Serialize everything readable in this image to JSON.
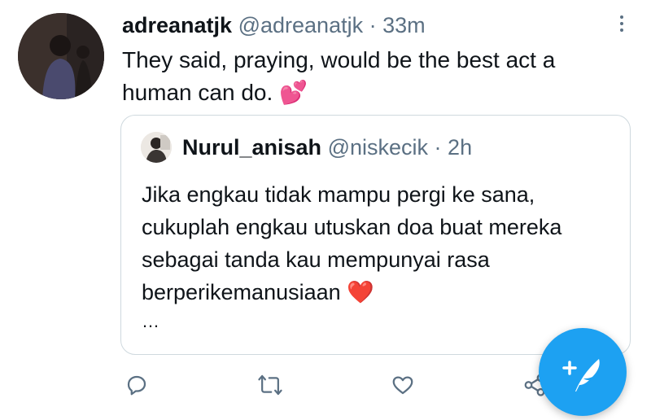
{
  "tweet": {
    "display_name": "adreanatjk",
    "handle": "@adreanatjk",
    "separator": "·",
    "time": "33m",
    "text": "They said, praying, would be the best act a human can do.",
    "emoji": "💕"
  },
  "quoted_tweet": {
    "display_name": "Nurul_anisah",
    "handle": "@niskecik",
    "separator": "·",
    "time": "2h",
    "text": "Jika engkau tidak mampu pergi ke sana, cukuplah engkau utuskan doa buat mereka sebagai tanda kau mempunyai rasa berperikemanusiaan",
    "emoji": "❤️",
    "truncation": "…"
  },
  "actions": {
    "icons": [
      "reply-icon",
      "retweet-icon",
      "like-icon",
      "share-icon"
    ]
  },
  "fab": {
    "icon": "compose-tweet-icon",
    "color": "#1da1f2"
  },
  "colors": {
    "text": "#0f1419",
    "muted": "#5b7083",
    "accent": "#1da1f2",
    "border": "#cfd9de"
  }
}
